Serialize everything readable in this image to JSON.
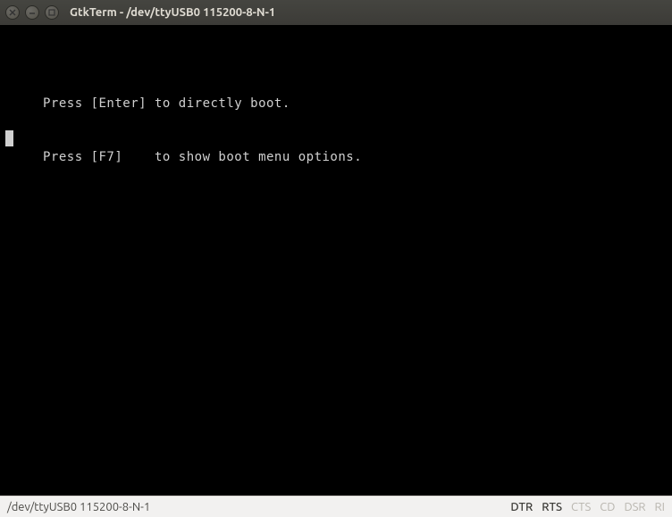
{
  "titlebar": {
    "title": "GtkTerm - /dev/ttyUSB0  115200-8-N-1"
  },
  "terminal": {
    "line1": "Press [Enter] to directly boot.",
    "line2": "Press [F7]    to show boot menu options."
  },
  "statusbar": {
    "left": "/dev/ttyUSB0  115200-8-N-1",
    "signals": {
      "dtr": "DTR",
      "rts": "RTS",
      "cts": "CTS",
      "cd": "CD",
      "dsr": "DSR",
      "ri": "RI"
    }
  }
}
